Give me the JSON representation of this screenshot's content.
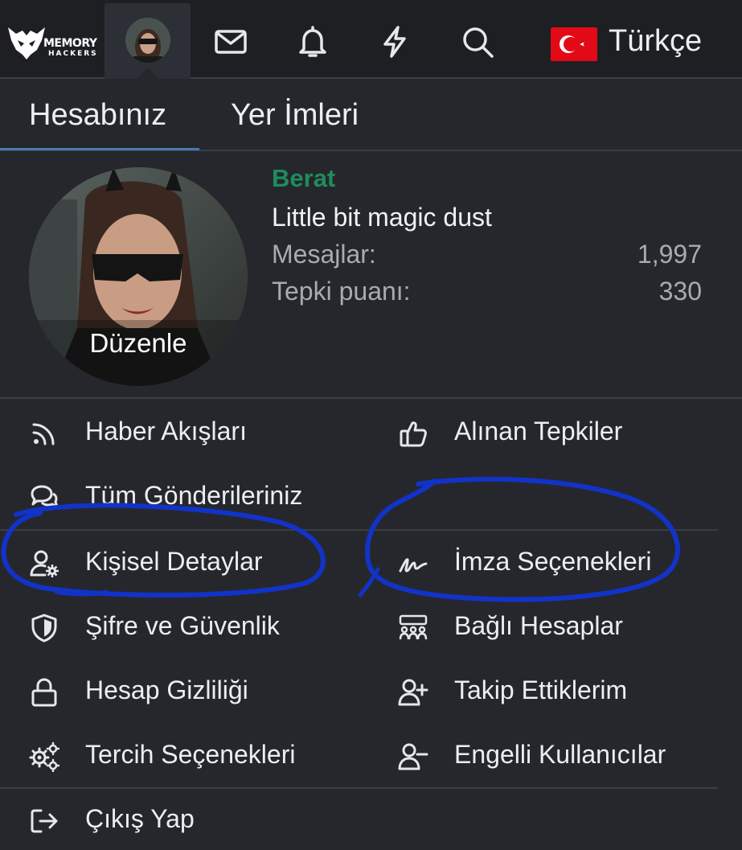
{
  "logo": {
    "line1": "MEMORY",
    "line2": "HACKERS"
  },
  "nav": {
    "icons": [
      "envelope-icon",
      "bell-icon",
      "bolt-icon",
      "search-icon"
    ],
    "language": "Türkçe"
  },
  "tabs": [
    {
      "label": "Hesabınız",
      "active": true
    },
    {
      "label": "Yer İmleri",
      "active": false
    }
  ],
  "profile": {
    "edit_label": "Düzenle",
    "username": "Berat",
    "user_title": "Little bit magic dust",
    "stats": [
      {
        "label": "Mesajlar:",
        "value": "1,997"
      },
      {
        "label": "Tepki puanı:",
        "value": "330"
      }
    ]
  },
  "menu": {
    "feeds": "Haber Akışları",
    "reactions_received": "Alınan Tepkiler",
    "your_posts": "Tüm Gönderileriniz",
    "personal_details": "Kişisel Detaylar",
    "signature": "İmza Seçenekleri",
    "password_security": "Şifre ve Güvenlik",
    "connected_accounts": "Bağlı Hesaplar",
    "privacy": "Hesap Gizliliği",
    "following": "Takip Ettiklerim",
    "preferences": "Tercih Seçenekleri",
    "ignored_users": "Engelli Kullanıcılar",
    "logout": "Çıkış Yap"
  },
  "colors": {
    "background": "#25272d",
    "topbar": "#1d1f23",
    "username": "#1f8c5c",
    "tab_underline": "#4a7ab4",
    "annotation": "#1233c8",
    "flag": "#e30a17"
  }
}
